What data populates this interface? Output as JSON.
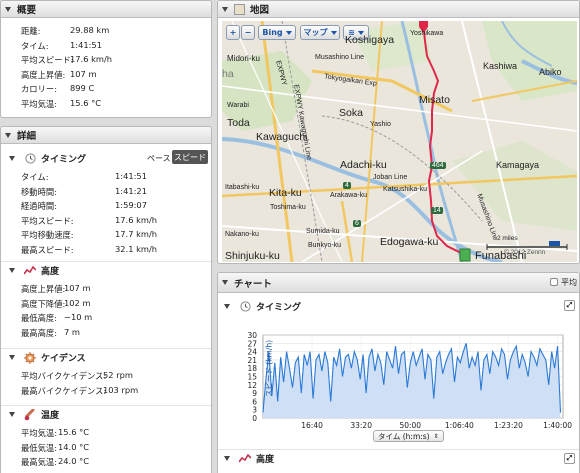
{
  "summary": {
    "title": "概要",
    "rows": [
      {
        "label": "距離:",
        "value": "29.88 km"
      },
      {
        "label": "タイム:",
        "value": "1:41:51"
      },
      {
        "label": "平均スピード:",
        "value": "17.6 km/h"
      },
      {
        "label": "高度上昇値:",
        "value": "107 m"
      },
      {
        "label": "カロリー:",
        "value": "899 C"
      },
      {
        "label": "平均気温:",
        "value": "15.6 °C"
      }
    ]
  },
  "details": {
    "title": "詳細",
    "timing": {
      "title": "タイミング",
      "toggle_pace": "ペース",
      "toggle_speed": "スピード",
      "rows": [
        {
          "label": "タイム:",
          "value": "1:41:51"
        },
        {
          "label": "移動時間:",
          "value": "1:41:21"
        },
        {
          "label": "経過時間:",
          "value": "1:59:07"
        },
        {
          "label": "平均スピード:",
          "value": "17.6 km/h"
        },
        {
          "label": "平均移動速度:",
          "value": "17.7 km/h"
        },
        {
          "label": "最高スピード:",
          "value": "32.1 km/h"
        }
      ]
    },
    "elevation": {
      "title": "高度",
      "rows": [
        {
          "label": "高度上昇値:",
          "value": "107 m"
        },
        {
          "label": "高度下降値:",
          "value": "102 m"
        },
        {
          "label": "最低高度:",
          "value": "−10 m"
        },
        {
          "label": "最高高度:",
          "value": "7 m"
        }
      ]
    },
    "cadence": {
      "title": "ケイデンス",
      "rows": [
        {
          "label": "平均バイクケイデンス:",
          "value": "52 rpm"
        },
        {
          "label": "最高バイクケイデンス:",
          "value": "103 rpm"
        }
      ]
    },
    "temperature": {
      "title": "温度",
      "rows": [
        {
          "label": "平均気温:",
          "value": "15.6 °C"
        },
        {
          "label": "最低気温:",
          "value": "14.0 °C"
        },
        {
          "label": "最高気温:",
          "value": "24.0 °C"
        }
      ]
    }
  },
  "map": {
    "title": "地図",
    "zoom_in": "+",
    "zoom_out": "−",
    "provider_button": "Bing",
    "map_button": "マップ",
    "scale": "2 miles",
    "copyright": "© 2012 Zenrin",
    "labels": [
      "Yoshikawa",
      "Koshigaya",
      "Midori-ku",
      "Musashino Line",
      "Kashiwa",
      "Abiko",
      "Tokyogaikan Exp",
      "Misato",
      "Warabi",
      "Soka",
      "Yashio",
      "Toda",
      "Kawaguchi",
      "Adachi-ku",
      "Kamagaya",
      "Joban Line",
      "Itabashi-ku",
      "Kita-ku",
      "Arakawa-ku",
      "Katsushika-ku",
      "Toshima-ku",
      "Nakano-ku",
      "Sumida-ku",
      "Bunkyo-ku",
      "Edogawa-ku",
      "Shinjuku-ku",
      "Funabashi",
      "Musashino Line",
      "ha",
      "4",
      "6",
      "14",
      "464",
      "EXPWY",
      "EXPWY Kawaguchi Line",
      "Nakano-ku"
    ]
  },
  "chart_panel": {
    "title": "チャート",
    "average_label": "平均",
    "timing_title": "タイミング",
    "x_axis_select": "タイム (h:m:s)",
    "elevation_title": "高度"
  },
  "chart_data": {
    "type": "area",
    "title": "",
    "xlabel": "タイム (h:m:s)",
    "ylabel": "スピード (km/h)",
    "ylim": [
      0,
      30
    ],
    "x_ticks": [
      "16:40",
      "33:20",
      "50:00",
      "1:06:40",
      "1:23:20",
      "1:40:00"
    ],
    "y_ticks": [
      0,
      3,
      6,
      9,
      12,
      15,
      18,
      21,
      24,
      27,
      30
    ],
    "grid": true,
    "legend": "none",
    "series": [
      {
        "color": "#2a7ad6",
        "x_minutes": [
          0,
          1,
          2,
          3,
          4,
          5,
          6,
          7,
          8,
          9,
          10,
          11,
          12,
          13,
          14,
          15,
          16,
          17,
          18,
          19,
          20,
          21,
          22,
          23,
          24,
          25,
          26,
          27,
          28,
          29,
          30,
          31,
          32,
          33,
          34,
          35,
          36,
          37,
          38,
          39,
          40,
          41,
          42,
          43,
          44,
          45,
          46,
          47,
          48,
          49,
          50,
          51,
          52,
          53,
          54,
          55,
          56,
          57,
          58,
          59,
          60,
          61,
          62,
          63,
          64,
          65,
          66,
          67,
          68,
          69,
          70,
          71,
          72,
          73,
          74,
          75,
          76,
          77,
          78,
          79,
          80,
          81,
          82,
          83,
          84,
          85,
          86,
          87,
          88,
          89,
          90,
          91,
          92,
          93,
          94,
          95,
          96,
          97,
          98,
          99,
          100,
          101
        ],
        "values": [
          2,
          14,
          24,
          8,
          20,
          6,
          22,
          13,
          24,
          18,
          11,
          20,
          22,
          9,
          23,
          19,
          24,
          7,
          21,
          23,
          17,
          24,
          20,
          6,
          22,
          19,
          25,
          15,
          22,
          23,
          18,
          24,
          21,
          14,
          23,
          9,
          22,
          25,
          17,
          23,
          20,
          12,
          24,
          21,
          18,
          26,
          16,
          23,
          24,
          11,
          20,
          24,
          19,
          22,
          25,
          14,
          23,
          21,
          7,
          22,
          24,
          16,
          20,
          23,
          25,
          13,
          22,
          20,
          24,
          27,
          18,
          22,
          19,
          24,
          10,
          21,
          23,
          16,
          24,
          22,
          19,
          25,
          23,
          14,
          21,
          24,
          26,
          18,
          23,
          20,
          15,
          24,
          22,
          19,
          25,
          23,
          21,
          12,
          24,
          18,
          26,
          2
        ]
      }
    ]
  },
  "colors": {
    "accent_track": "#e0274a",
    "chart_line": "#2a7ad6",
    "chart_fill": "#cfe0f6",
    "toggle_active_bg": "#555555"
  }
}
